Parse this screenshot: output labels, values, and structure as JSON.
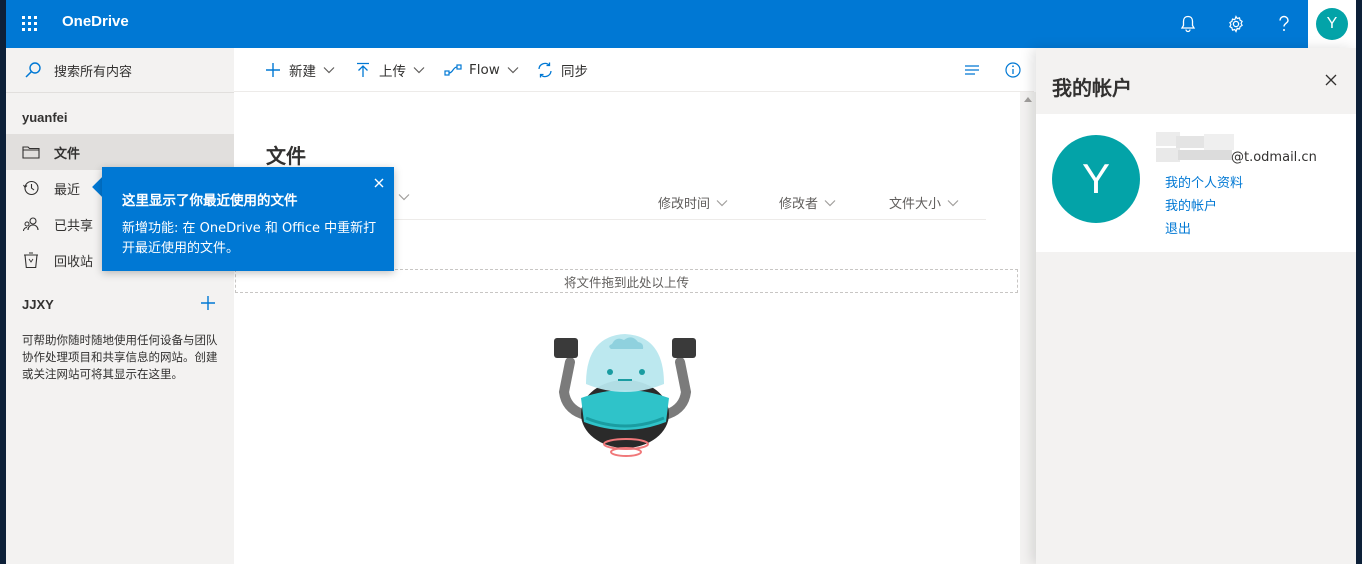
{
  "app": {
    "brand": "OneDrive",
    "user_initial": "Y"
  },
  "colors": {
    "accent": "#0078d4",
    "avatar": "#03a3a8",
    "nav_bg": "#f3f2f1"
  },
  "search": {
    "placeholder": "搜索所有内容"
  },
  "sidebar": {
    "account": "yuanfei",
    "items": [
      {
        "label": "文件",
        "icon": "folder-icon",
        "active": true
      },
      {
        "label": "最近",
        "icon": "clock-icon",
        "active": false
      },
      {
        "label": "已共享",
        "icon": "people-icon",
        "active": false
      },
      {
        "label": "回收站",
        "icon": "recycle-bin-icon",
        "active": false
      }
    ],
    "sites_title": "JJXY",
    "sites_description": "可帮助你随时随地使用任何设备与团队协作处理项目和共享信息的网站。创建或关注网站可将其显示在这里。"
  },
  "toolbar": {
    "new_label": "新建",
    "upload_label": "上传",
    "flow_label": "Flow",
    "sync_label": "同步"
  },
  "main": {
    "title": "文件",
    "columns": {
      "modified": "修改时间",
      "modified_by": "修改者",
      "size": "文件大小"
    },
    "dropzone": "将文件拖到此处以上传"
  },
  "callout": {
    "title": "这里显示了你最近使用的文件",
    "body": "新增功能: 在 OneDrive 和 Office 中重新打开最近使用的文件。"
  },
  "account_panel": {
    "title": "我的帐户",
    "avatar_initial": "Y",
    "email": "@t.odmail.cn",
    "links": [
      "我的个人资料",
      "我的帐户",
      "退出"
    ]
  }
}
